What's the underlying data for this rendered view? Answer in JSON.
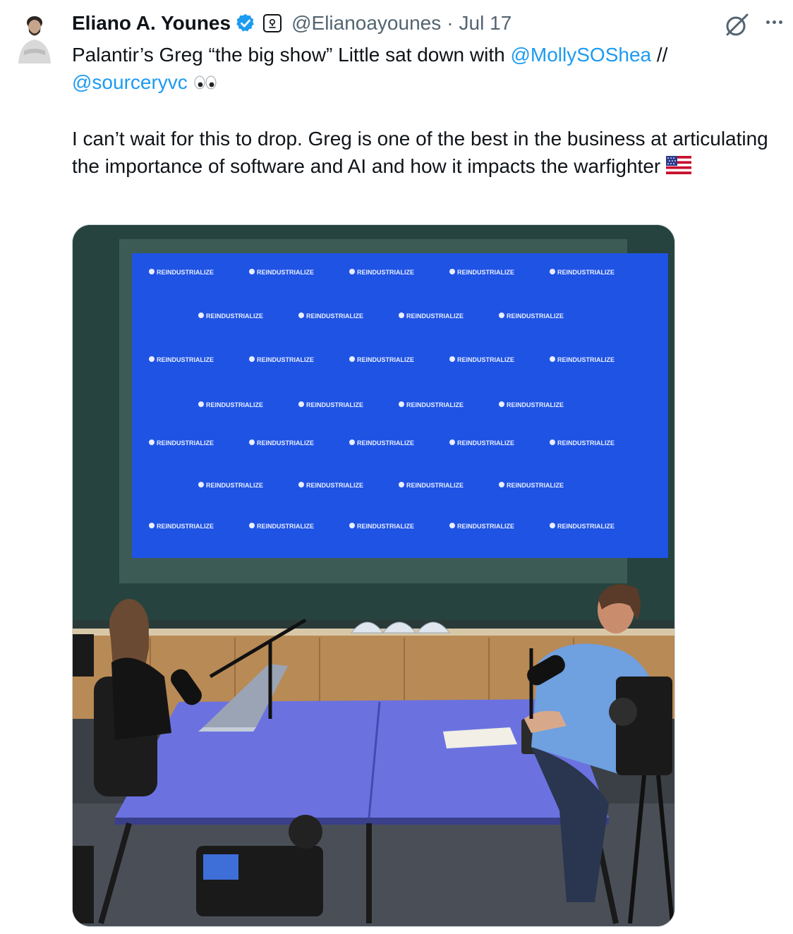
{
  "tweet": {
    "author_name": "Eliano A. Younes",
    "handle": "@Elianoayounes",
    "separator": "·",
    "date": "Jul 17",
    "line1_prefix": "Palantir’s Greg “the big show” Little sat down with ",
    "mention1": "@MollySOShea",
    "line1_suffix": " //",
    "mention2": "@sourceryvc",
    "paragraph2": "I can’t wait for this to drop. Greg is one of the best in the business at articulating the importance of software and AI and how it impacts the warfighter"
  },
  "media": {
    "screen_text": "REINDUSTRIALIZE",
    "screen_color": "#1f53e4"
  },
  "icons": [
    "verified-badge-icon",
    "affiliate-badge-icon",
    "grok-icon",
    "more-icon",
    "eyes-emoji-icon",
    "us-flag-emoji-icon"
  ],
  "colors": {
    "link": "#1d9bf0",
    "secondary_text": "#536471",
    "verified": "#1d9bf0"
  }
}
